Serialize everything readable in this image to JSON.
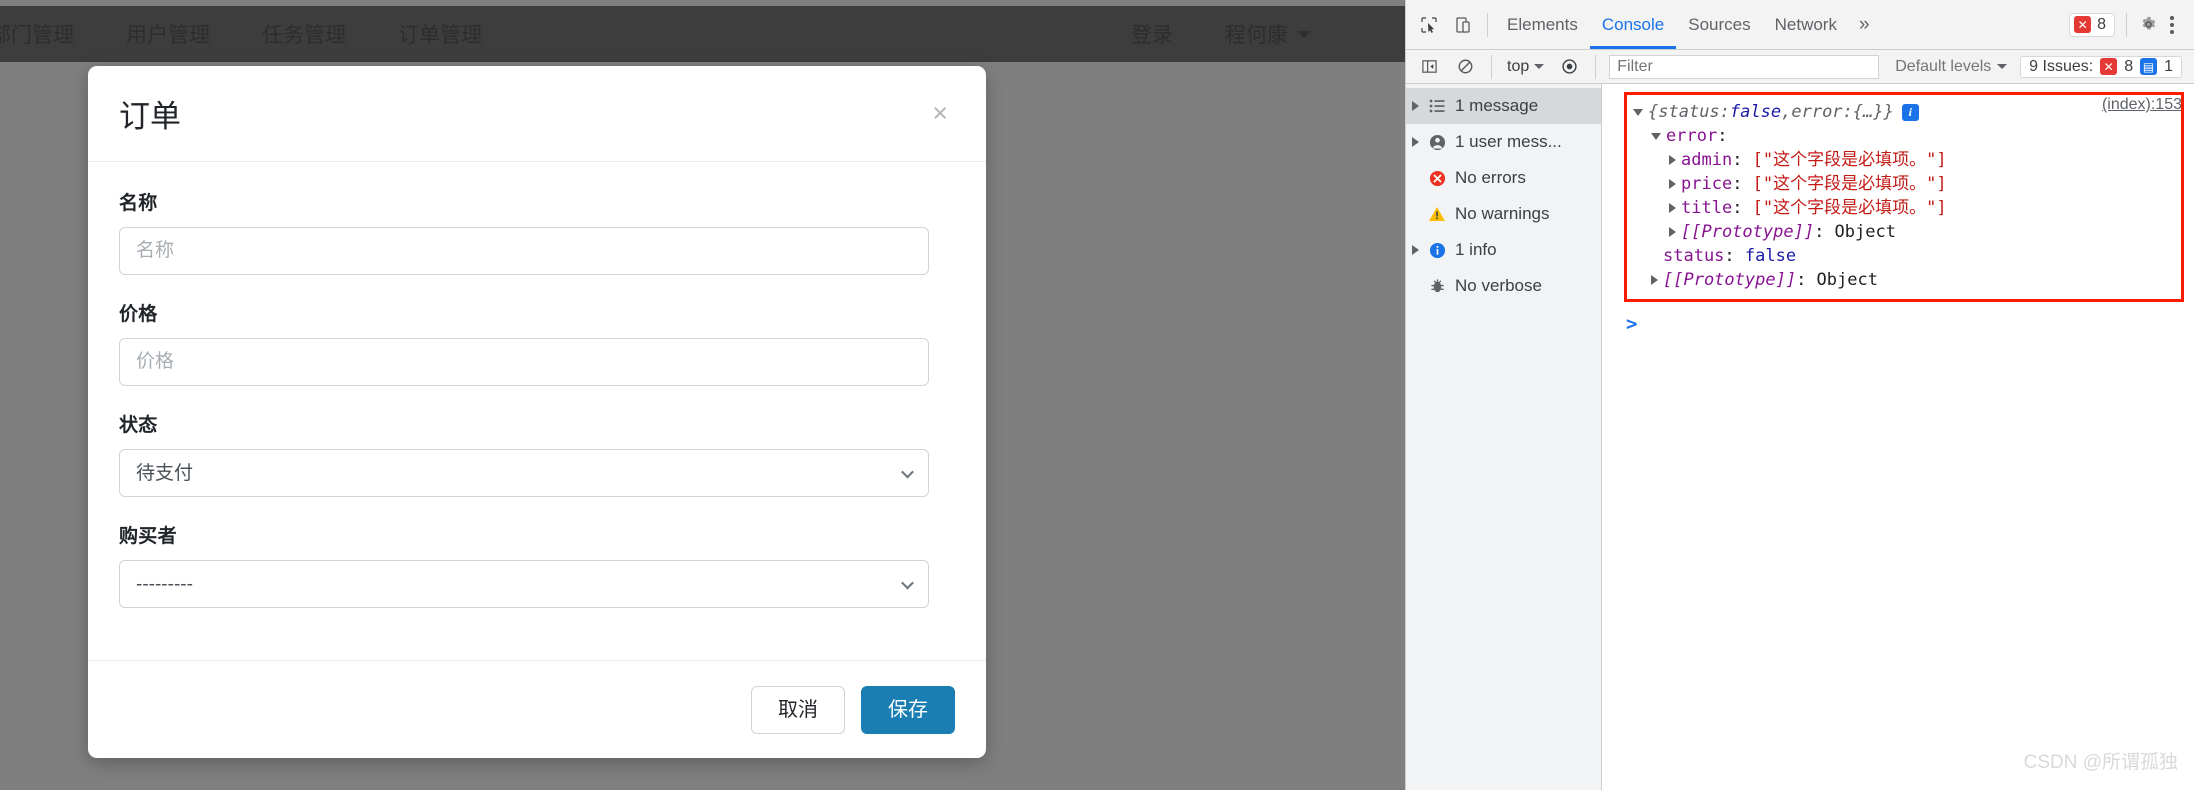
{
  "page": {
    "navbar": {
      "left_items": [
        {
          "label": "部门管理"
        },
        {
          "label": "用户管理"
        },
        {
          "label": "任务管理"
        },
        {
          "label": "订单管理"
        }
      ],
      "right_items": [
        {
          "label": "登录"
        },
        {
          "label": "程何康"
        }
      ]
    }
  },
  "modal": {
    "title": "订单",
    "close_label": "×",
    "fields": [
      {
        "label": "名称",
        "type": "text",
        "value": "",
        "placeholder": "名称"
      },
      {
        "label": "价格",
        "type": "text",
        "value": "",
        "placeholder": "价格"
      },
      {
        "label": "状态",
        "type": "select",
        "value": "待支付"
      },
      {
        "label": "购买者",
        "type": "select",
        "value": "---------"
      }
    ],
    "buttons": {
      "cancel": "取消",
      "save": "保存"
    },
    "accent_color": "#1b7eb3"
  },
  "devtools": {
    "tabs": [
      {
        "label": "Elements",
        "active": false
      },
      {
        "label": "Console",
        "active": true
      },
      {
        "label": "Sources",
        "active": false
      },
      {
        "label": "Network",
        "active": false
      }
    ],
    "more_tabs_label": "»",
    "error_badge_count": "8",
    "toolbar": {
      "context": "top",
      "filter_placeholder": "Filter",
      "filter_value": "",
      "levels": "Default levels",
      "issues_label": "9 Issues:",
      "issues_errors": "8",
      "issues_messages": "1"
    },
    "sidebar": [
      {
        "label": "1 message",
        "icon": "list-icon",
        "expandable": true,
        "selected": true
      },
      {
        "label": "1 user mess...",
        "icon": "user-icon",
        "expandable": true,
        "selected": false
      },
      {
        "label": "No errors",
        "icon": "error-icon",
        "expandable": false,
        "selected": false
      },
      {
        "label": "No warnings",
        "icon": "warning-icon",
        "expandable": false,
        "selected": false
      },
      {
        "label": "1 info",
        "icon": "info-icon",
        "expandable": true,
        "selected": false
      },
      {
        "label": "No verbose",
        "icon": "verbose-icon",
        "expandable": false,
        "selected": false
      }
    ],
    "console_message": {
      "source_link": "(index):153",
      "summary_open": "{",
      "summary_key1": "status",
      "summary_colon": ": ",
      "summary_val1": "false",
      "summary_comma": ", ",
      "summary_key2": "error",
      "summary_val2": "{…}",
      "summary_close": "}",
      "error_key": "error",
      "error_entries": [
        {
          "key": "admin",
          "value": "[\"这个字段是必填项。\"]"
        },
        {
          "key": "price",
          "value": "[\"这个字段是必填项。\"]"
        },
        {
          "key": "title",
          "value": "[\"这个字段是必填项。\"]"
        }
      ],
      "inner_prototype_key": "[[Prototype]]",
      "inner_prototype_value": "Object",
      "status_key": "status",
      "status_value": "false",
      "outer_prototype_key": "[[Prototype]]",
      "outer_prototype_value": "Object"
    },
    "prompt": ">"
  },
  "watermark": "CSDN @所谓孤独"
}
